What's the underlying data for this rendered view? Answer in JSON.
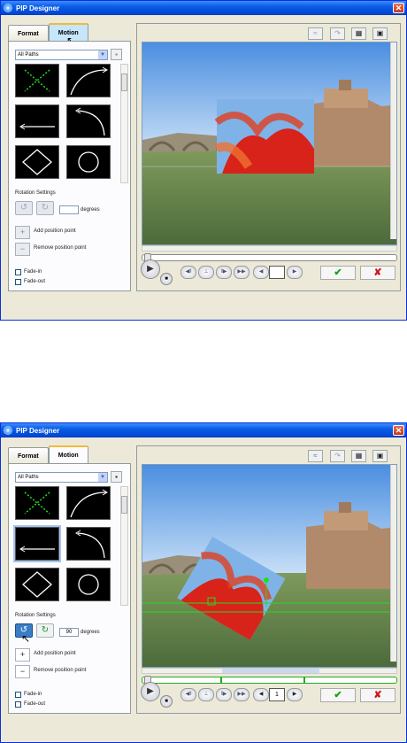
{
  "window": {
    "title": "PIP Designer",
    "close_glyph": "✕"
  },
  "tabs": [
    {
      "label": "Format"
    },
    {
      "label": "Motion"
    }
  ],
  "paths": {
    "selected": "All Paths"
  },
  "rotation": {
    "heading": "Rotation Settings",
    "unit": "degrees",
    "value_top": "",
    "value_bottom": "90"
  },
  "points": {
    "add_label": "Add position point",
    "remove_label": "Remove position point"
  },
  "fades": {
    "fade_in": "Fade-in",
    "fade_out": "Fade-out"
  },
  "playback": {
    "frame_top": "",
    "frame_bottom": "1"
  },
  "icons": {
    "close": "close-icon",
    "play": "play-icon",
    "stop": "stop-icon",
    "ok": "checkmark-icon",
    "cancel": "x-icon",
    "rotate_ccw": "rotate-ccw-icon",
    "rotate_cw": "rotate-cw-icon"
  },
  "colors": {
    "title_bar": "#0a5ce5",
    "ok": "#18a018",
    "cancel": "#d01818",
    "path_line": "#22dd22"
  }
}
